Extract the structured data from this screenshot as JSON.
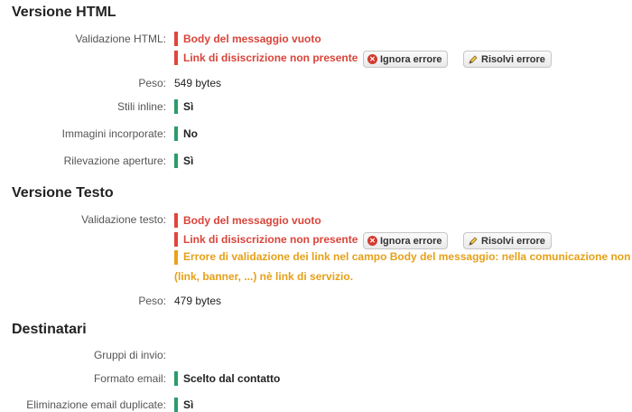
{
  "html_section": {
    "title": "Versione HTML",
    "validation_label": "Validazione HTML:",
    "errors": [
      "Body del messaggio vuoto",
      "Link di disiscrizione non presente"
    ],
    "weight_label": "Peso:",
    "weight_value": "549 bytes",
    "inline_styles_label": "Stili inline:",
    "inline_styles_value": "Sì",
    "embedded_images_label": "Immagini incorporate:",
    "embedded_images_value": "No",
    "open_tracking_label": "Rilevazione aperture:",
    "open_tracking_value": "Sì"
  },
  "text_section": {
    "title": "Versione Testo",
    "validation_label": "Validazione testo:",
    "errors": [
      "Body del messaggio vuoto",
      "Link di disiscrizione non presente"
    ],
    "warning_line1": "Errore di validazione dei link nel campo Body del messaggio: nella comunicazione non so",
    "warning_line2": "(link, banner, ...) nè link di servizio.",
    "weight_label": "Peso:",
    "weight_value": "479 bytes"
  },
  "recipients_section": {
    "title": "Destinatari",
    "groups_label": "Gruppi di invio:",
    "format_label": "Formato email:",
    "format_value": "Scelto dal contatto",
    "dedupe_label": "Eliminazione email duplicate:",
    "dedupe_value": "Sì"
  },
  "buttons": {
    "ignore": "Ignora errore",
    "resolve": "Risolvi errore"
  },
  "colors": {
    "error": "#e0463b",
    "ok": "#2a9d6c",
    "warning": "#e9a21a"
  },
  "icons": {
    "ignore": "x-circle-icon",
    "resolve": "pencil-icon"
  }
}
